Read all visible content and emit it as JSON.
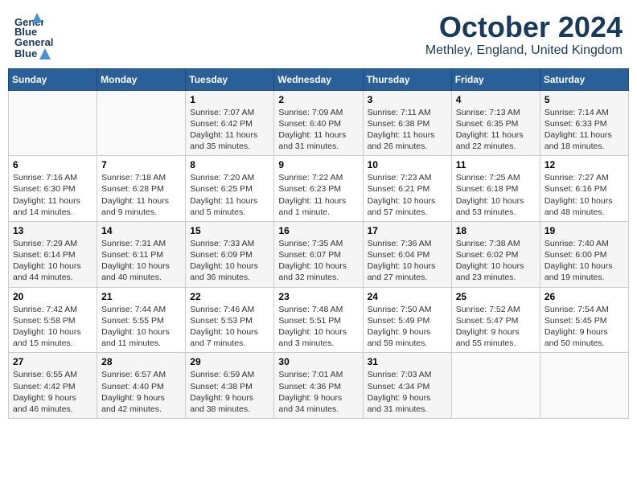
{
  "logo": {
    "line1": "General",
    "line2": "Blue",
    "bird": "▲"
  },
  "title": "October 2024",
  "location": "Methley, England, United Kingdom",
  "days_of_week": [
    "Sunday",
    "Monday",
    "Tuesday",
    "Wednesday",
    "Thursday",
    "Friday",
    "Saturday"
  ],
  "weeks": [
    [
      {
        "day": "",
        "info": ""
      },
      {
        "day": "",
        "info": ""
      },
      {
        "day": "1",
        "info": "Sunrise: 7:07 AM\nSunset: 6:42 PM\nDaylight: 11 hours\nand 35 minutes."
      },
      {
        "day": "2",
        "info": "Sunrise: 7:09 AM\nSunset: 6:40 PM\nDaylight: 11 hours\nand 31 minutes."
      },
      {
        "day": "3",
        "info": "Sunrise: 7:11 AM\nSunset: 6:38 PM\nDaylight: 11 hours\nand 26 minutes."
      },
      {
        "day": "4",
        "info": "Sunrise: 7:13 AM\nSunset: 6:35 PM\nDaylight: 11 hours\nand 22 minutes."
      },
      {
        "day": "5",
        "info": "Sunrise: 7:14 AM\nSunset: 6:33 PM\nDaylight: 11 hours\nand 18 minutes."
      }
    ],
    [
      {
        "day": "6",
        "info": "Sunrise: 7:16 AM\nSunset: 6:30 PM\nDaylight: 11 hours\nand 14 minutes."
      },
      {
        "day": "7",
        "info": "Sunrise: 7:18 AM\nSunset: 6:28 PM\nDaylight: 11 hours\nand 9 minutes."
      },
      {
        "day": "8",
        "info": "Sunrise: 7:20 AM\nSunset: 6:25 PM\nDaylight: 11 hours\nand 5 minutes."
      },
      {
        "day": "9",
        "info": "Sunrise: 7:22 AM\nSunset: 6:23 PM\nDaylight: 11 hours\nand 1 minute."
      },
      {
        "day": "10",
        "info": "Sunrise: 7:23 AM\nSunset: 6:21 PM\nDaylight: 10 hours\nand 57 minutes."
      },
      {
        "day": "11",
        "info": "Sunrise: 7:25 AM\nSunset: 6:18 PM\nDaylight: 10 hours\nand 53 minutes."
      },
      {
        "day": "12",
        "info": "Sunrise: 7:27 AM\nSunset: 6:16 PM\nDaylight: 10 hours\nand 48 minutes."
      }
    ],
    [
      {
        "day": "13",
        "info": "Sunrise: 7:29 AM\nSunset: 6:14 PM\nDaylight: 10 hours\nand 44 minutes."
      },
      {
        "day": "14",
        "info": "Sunrise: 7:31 AM\nSunset: 6:11 PM\nDaylight: 10 hours\nand 40 minutes."
      },
      {
        "day": "15",
        "info": "Sunrise: 7:33 AM\nSunset: 6:09 PM\nDaylight: 10 hours\nand 36 minutes."
      },
      {
        "day": "16",
        "info": "Sunrise: 7:35 AM\nSunset: 6:07 PM\nDaylight: 10 hours\nand 32 minutes."
      },
      {
        "day": "17",
        "info": "Sunrise: 7:36 AM\nSunset: 6:04 PM\nDaylight: 10 hours\nand 27 minutes."
      },
      {
        "day": "18",
        "info": "Sunrise: 7:38 AM\nSunset: 6:02 PM\nDaylight: 10 hours\nand 23 minutes."
      },
      {
        "day": "19",
        "info": "Sunrise: 7:40 AM\nSunset: 6:00 PM\nDaylight: 10 hours\nand 19 minutes."
      }
    ],
    [
      {
        "day": "20",
        "info": "Sunrise: 7:42 AM\nSunset: 5:58 PM\nDaylight: 10 hours\nand 15 minutes."
      },
      {
        "day": "21",
        "info": "Sunrise: 7:44 AM\nSunset: 5:55 PM\nDaylight: 10 hours\nand 11 minutes."
      },
      {
        "day": "22",
        "info": "Sunrise: 7:46 AM\nSunset: 5:53 PM\nDaylight: 10 hours\nand 7 minutes."
      },
      {
        "day": "23",
        "info": "Sunrise: 7:48 AM\nSunset: 5:51 PM\nDaylight: 10 hours\nand 3 minutes."
      },
      {
        "day": "24",
        "info": "Sunrise: 7:50 AM\nSunset: 5:49 PM\nDaylight: 9 hours\nand 59 minutes."
      },
      {
        "day": "25",
        "info": "Sunrise: 7:52 AM\nSunset: 5:47 PM\nDaylight: 9 hours\nand 55 minutes."
      },
      {
        "day": "26",
        "info": "Sunrise: 7:54 AM\nSunset: 5:45 PM\nDaylight: 9 hours\nand 50 minutes."
      }
    ],
    [
      {
        "day": "27",
        "info": "Sunrise: 6:55 AM\nSunset: 4:42 PM\nDaylight: 9 hours\nand 46 minutes."
      },
      {
        "day": "28",
        "info": "Sunrise: 6:57 AM\nSunset: 4:40 PM\nDaylight: 9 hours\nand 42 minutes."
      },
      {
        "day": "29",
        "info": "Sunrise: 6:59 AM\nSunset: 4:38 PM\nDaylight: 9 hours\nand 38 minutes."
      },
      {
        "day": "30",
        "info": "Sunrise: 7:01 AM\nSunset: 4:36 PM\nDaylight: 9 hours\nand 34 minutes."
      },
      {
        "day": "31",
        "info": "Sunrise: 7:03 AM\nSunset: 4:34 PM\nDaylight: 9 hours\nand 31 minutes."
      },
      {
        "day": "",
        "info": ""
      },
      {
        "day": "",
        "info": ""
      }
    ]
  ]
}
